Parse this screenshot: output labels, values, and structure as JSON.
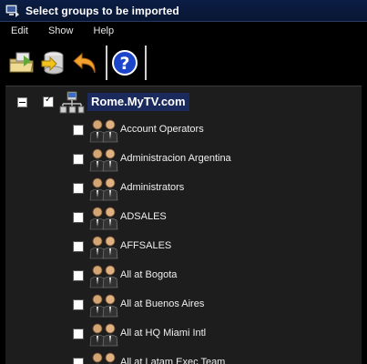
{
  "window": {
    "title": "Select groups to be imported",
    "icon": "import-window-icon"
  },
  "menu": {
    "items": [
      {
        "label": "Edit"
      },
      {
        "label": "Show"
      },
      {
        "label": "Help"
      }
    ]
  },
  "toolbar": {
    "buttons": [
      {
        "icon": "import-folder-icon"
      },
      {
        "icon": "database-import-icon"
      },
      {
        "icon": "undo-arrow-icon"
      },
      {
        "icon": "help-icon"
      }
    ]
  },
  "tree": {
    "root": {
      "label": "Rome.MyTV.com",
      "expanded": true,
      "checked": true,
      "icon": "network-domain-icon"
    },
    "groups": [
      {
        "label": "Account Operators",
        "checked": false
      },
      {
        "label": "Administracion Argentina",
        "checked": false
      },
      {
        "label": "Administrators",
        "checked": false
      },
      {
        "label": "ADSALES",
        "checked": false
      },
      {
        "label": "AFFSALES",
        "checked": false
      },
      {
        "label": "All at Bogota",
        "checked": false
      },
      {
        "label": "All at Buenos Aires",
        "checked": false
      },
      {
        "label": "All at HQ Miami Intl",
        "checked": false
      },
      {
        "label": "All at Latam Exec Team",
        "checked": false
      }
    ]
  },
  "colors": {
    "titlebar": "#0b1d44",
    "root_highlight": "#1a2a5c",
    "tree_background": "#1d1d1d"
  }
}
